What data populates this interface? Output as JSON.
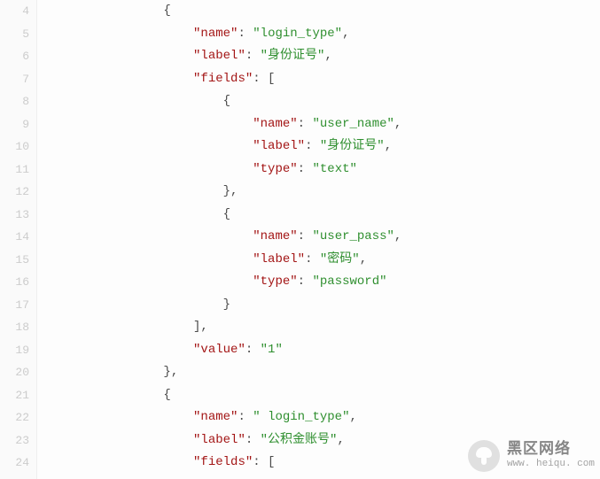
{
  "editor": {
    "lineStart": 4,
    "lines": [
      {
        "indent": 4,
        "tokens": [
          {
            "cls": "p",
            "t": "{"
          }
        ]
      },
      {
        "indent": 5,
        "tokens": [
          {
            "cls": "key",
            "t": "\"name\""
          },
          {
            "cls": "p",
            "t": ": "
          },
          {
            "cls": "str",
            "t": "\"login_type\""
          },
          {
            "cls": "p",
            "t": ","
          }
        ]
      },
      {
        "indent": 5,
        "tokens": [
          {
            "cls": "key",
            "t": "\"label\""
          },
          {
            "cls": "p",
            "t": ": "
          },
          {
            "cls": "str",
            "t": "\"身份证号\""
          },
          {
            "cls": "p",
            "t": ","
          }
        ]
      },
      {
        "indent": 5,
        "tokens": [
          {
            "cls": "key",
            "t": "\"fields\""
          },
          {
            "cls": "p",
            "t": ": ["
          }
        ]
      },
      {
        "indent": 6,
        "tokens": [
          {
            "cls": "p",
            "t": "{"
          }
        ]
      },
      {
        "indent": 7,
        "tokens": [
          {
            "cls": "key",
            "t": "\"name\""
          },
          {
            "cls": "p",
            "t": ": "
          },
          {
            "cls": "str",
            "t": "\"user_name\""
          },
          {
            "cls": "p",
            "t": ","
          }
        ]
      },
      {
        "indent": 7,
        "tokens": [
          {
            "cls": "key",
            "t": "\"label\""
          },
          {
            "cls": "p",
            "t": ": "
          },
          {
            "cls": "str",
            "t": "\"身份证号\""
          },
          {
            "cls": "p",
            "t": ","
          }
        ]
      },
      {
        "indent": 7,
        "tokens": [
          {
            "cls": "key",
            "t": "\"type\""
          },
          {
            "cls": "p",
            "t": ": "
          },
          {
            "cls": "str",
            "t": "\"text\""
          }
        ]
      },
      {
        "indent": 6,
        "tokens": [
          {
            "cls": "p",
            "t": "},"
          }
        ]
      },
      {
        "indent": 6,
        "tokens": [
          {
            "cls": "p",
            "t": "{"
          }
        ]
      },
      {
        "indent": 7,
        "tokens": [
          {
            "cls": "key",
            "t": "\"name\""
          },
          {
            "cls": "p",
            "t": ": "
          },
          {
            "cls": "str",
            "t": "\"user_pass\""
          },
          {
            "cls": "p",
            "t": ","
          }
        ]
      },
      {
        "indent": 7,
        "tokens": [
          {
            "cls": "key",
            "t": "\"label\""
          },
          {
            "cls": "p",
            "t": ": "
          },
          {
            "cls": "str",
            "t": "\"密码\""
          },
          {
            "cls": "p",
            "t": ","
          }
        ]
      },
      {
        "indent": 7,
        "tokens": [
          {
            "cls": "key",
            "t": "\"type\""
          },
          {
            "cls": "p",
            "t": ": "
          },
          {
            "cls": "str",
            "t": "\"password\""
          }
        ]
      },
      {
        "indent": 6,
        "tokens": [
          {
            "cls": "p",
            "t": "}"
          }
        ]
      },
      {
        "indent": 5,
        "tokens": [
          {
            "cls": "p",
            "t": "],"
          }
        ]
      },
      {
        "indent": 5,
        "tokens": [
          {
            "cls": "key",
            "t": "\"value\""
          },
          {
            "cls": "p",
            "t": ": "
          },
          {
            "cls": "str",
            "t": "\"1\""
          }
        ]
      },
      {
        "indent": 4,
        "tokens": [
          {
            "cls": "p",
            "t": "},"
          }
        ]
      },
      {
        "indent": 4,
        "tokens": [
          {
            "cls": "p",
            "t": "{"
          }
        ]
      },
      {
        "indent": 5,
        "tokens": [
          {
            "cls": "key",
            "t": "\"name\""
          },
          {
            "cls": "p",
            "t": ": "
          },
          {
            "cls": "str",
            "t": "\" login_type\""
          },
          {
            "cls": "p",
            "t": ","
          }
        ]
      },
      {
        "indent": 5,
        "tokens": [
          {
            "cls": "key",
            "t": "\"label\""
          },
          {
            "cls": "p",
            "t": ": "
          },
          {
            "cls": "str",
            "t": "\"公积金账号\""
          },
          {
            "cls": "p",
            "t": ","
          }
        ]
      },
      {
        "indent": 5,
        "tokens": [
          {
            "cls": "key",
            "t": "\"fields\""
          },
          {
            "cls": "p",
            "t": ": ["
          }
        ]
      }
    ]
  },
  "watermark": {
    "cn": "黑区网络",
    "en": "www. heiqu. com"
  }
}
